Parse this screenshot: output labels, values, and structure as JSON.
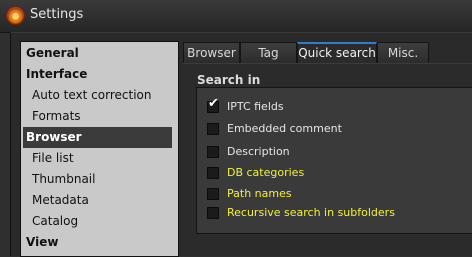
{
  "window": {
    "title": "Settings"
  },
  "sidebar": {
    "items": [
      {
        "label": "General",
        "kind": "section"
      },
      {
        "label": "Interface",
        "kind": "section"
      },
      {
        "label": "Auto text correction",
        "kind": "sub"
      },
      {
        "label": "Formats",
        "kind": "sub"
      },
      {
        "label": "Browser",
        "kind": "section",
        "selected": true
      },
      {
        "label": "File list",
        "kind": "sub"
      },
      {
        "label": "Thumbnail",
        "kind": "sub"
      },
      {
        "label": "Metadata",
        "kind": "sub"
      },
      {
        "label": "Catalog",
        "kind": "sub"
      },
      {
        "label": "View",
        "kind": "section"
      }
    ]
  },
  "tabs": [
    {
      "label": "Browser"
    },
    {
      "label": "Tag"
    },
    {
      "label": "Quick search",
      "active": true
    },
    {
      "label": "Misc."
    }
  ],
  "search_in": {
    "title": "Search in",
    "options": [
      {
        "label": "IPTC fields",
        "checked": true,
        "color": "#e6e6e6"
      },
      {
        "label": "Embedded comment",
        "checked": false,
        "color": "#e6e6e6"
      },
      {
        "label": "Description",
        "checked": false,
        "color": "#e6e6e6"
      },
      {
        "label": "DB categories",
        "checked": false,
        "color": "#f4f03a"
      },
      {
        "label": "Path names",
        "checked": false,
        "color": "#f4f03a"
      },
      {
        "label": "Recursive search in subfolders",
        "checked": false,
        "color": "#f4f03a"
      }
    ],
    "check_glyph": "✔"
  },
  "colors": {
    "tab_accent": "#2c7fd0",
    "highlight_text": "#f4f03a"
  }
}
